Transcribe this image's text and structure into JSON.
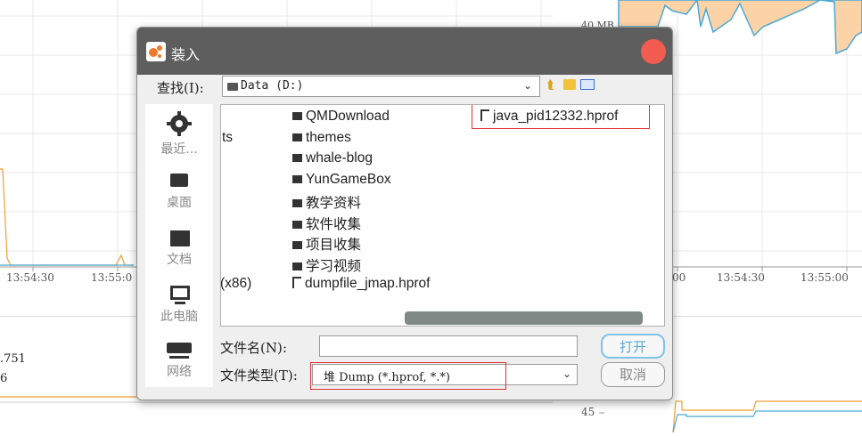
{
  "background": {
    "left_times": [
      "13:54:30",
      "13:55:0"
    ],
    "right_times": [
      "00",
      "13:54:30",
      "13:55:00"
    ],
    "right_top_label": "40 MB",
    "right_bottom_label": "45",
    "left_values": [
      ".751",
      "6"
    ],
    "colors": {
      "orange": "#f0a030",
      "blue": "#4aa8d8",
      "fill": "#fbd3a6"
    }
  },
  "dialog": {
    "title": "装入",
    "lookin_label": "查找(I):",
    "lookin_value": "Data (D:)",
    "toolbar_icons": [
      "up-folder-icon",
      "new-folder-icon",
      "view-menu-icon"
    ],
    "places": [
      {
        "label": "最近...",
        "icon": "recent-icon"
      },
      {
        "label": "桌面",
        "icon": "desktop-icon"
      },
      {
        "label": "文档",
        "icon": "documents-icon"
      },
      {
        "label": "此电脑",
        "icon": "computer-icon"
      },
      {
        "label": "网络",
        "icon": "network-icon"
      }
    ],
    "partial_col": [
      "ts",
      "(x86)"
    ],
    "folders": [
      "QMDownload",
      "themes",
      "whale-blog",
      "YunGameBox",
      "教学资料",
      "软件收集",
      "项目收集",
      "学习视频"
    ],
    "files": [
      "dumpfile_jmap.hprof",
      "java_pid12332.hprof"
    ],
    "filename_label": "文件名(N):",
    "filename_value": "",
    "filetype_label": "文件类型(T):",
    "filetype_value": "堆 Dump (*.hprof, *.*)",
    "open_button": "打开",
    "cancel_button": "取消",
    "accent": "#f25b50"
  }
}
